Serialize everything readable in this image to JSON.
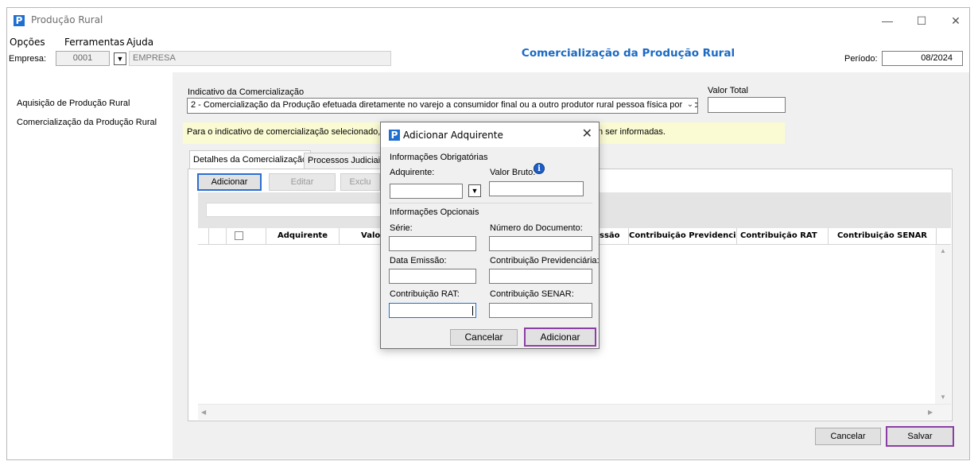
{
  "window": {
    "title": "Produção Rural",
    "icon_glyph": "P",
    "controls": {
      "minimize": "—",
      "maximize": "☐",
      "close": "✕"
    }
  },
  "menu": [
    "Opções",
    "Ferramentas",
    "Ajuda"
  ],
  "topbar": {
    "empresa_label": "Empresa:",
    "empresa_code": "0001",
    "empresa_name": "EMPRESA",
    "page_title": "Comercialização da Produção Rural",
    "periodo_label": "Período:",
    "periodo_value": "08/2024"
  },
  "sidebar": {
    "items": [
      "Aquisição de Produção Rural",
      "Comercialização da Produção Rural"
    ]
  },
  "form": {
    "indicativo_label": "Indicativo da Comercialização",
    "indicativo_value": "2 - Comercialização da Produção efetuada diretamente no varejo a consumidor final ou a outro produtor rural pessoa física por Produtor Rural",
    "valor_total_label": "Valor Total",
    "valor_total_value": "",
    "note_left": "Para o indicativo de comercialização selecionado, as",
    "note_right": "n ser informadas."
  },
  "tabs": [
    "Detalhes da Comercialização",
    "Processos Judiciais"
  ],
  "toolbar": {
    "add": "Adicionar",
    "edit": "Editar",
    "delete": "Exclu"
  },
  "grid": {
    "columns_left": [
      "Adquirente",
      "Valor"
    ],
    "columns_right": [
      "ssão",
      "Contribuição Previdenciá...",
      "Contribuição RAT",
      "Contribuição SENAR"
    ]
  },
  "footer": {
    "cancel": "Cancelar",
    "save": "Salvar"
  },
  "dialog": {
    "title": "Adicionar Adquirente",
    "close": "✕",
    "required_section": "Informações Obrigatórias",
    "adquirente_label": "Adquirente:",
    "valor_bruto_label": "Valor Bruto:",
    "optional_section": "Informações Opcionais",
    "serie_label": "Série:",
    "numero_label": "Número do Documento:",
    "data_label": "Data Emissão:",
    "contrib_prev_label": "Contribuição Previdenciária:",
    "contrib_rat_label": "Contribuição RAT:",
    "contrib_senar_label": "Contribuição SENAR:",
    "cancel": "Cancelar",
    "add": "Adicionar"
  },
  "colors": {
    "accent_blue": "#1b6ac4",
    "highlight_purple": "#8b3fa6",
    "note_yellow": "#fbfbd3"
  },
  "icons": {
    "app": "app-logo-icon",
    "dropdown": "dropdown-arrow-icon",
    "info": "info-icon"
  }
}
